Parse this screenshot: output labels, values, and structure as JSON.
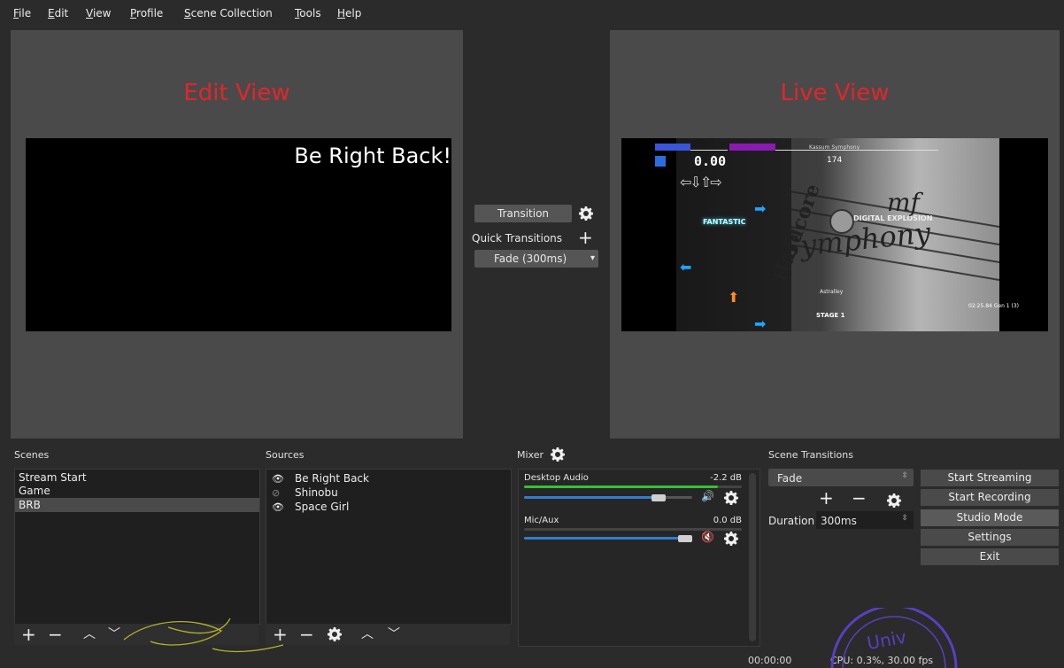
{
  "menu": {
    "items": [
      {
        "label": "File",
        "mnemonic": "F",
        "rest": "ile"
      },
      {
        "label": "Edit",
        "mnemonic": "E",
        "rest": "dit"
      },
      {
        "label": "View",
        "mnemonic": "V",
        "rest": "iew"
      },
      {
        "label": "Profile",
        "mnemonic": "P",
        "rest": "rofile"
      },
      {
        "label": "Scene Collection",
        "mnemonic": "S",
        "rest": "cene Collection"
      },
      {
        "label": "Tools",
        "mnemonic": "T",
        "rest": "ools"
      },
      {
        "label": "Help",
        "mnemonic": "H",
        "rest": "elp"
      }
    ]
  },
  "edit_view": {
    "label": "Edit View",
    "overlay_text": "Be Right Back!"
  },
  "live_view": {
    "label": "Live View",
    "game": {
      "score": "0.00",
      "song_title": "Kassum Symphony",
      "combo": "174",
      "judgement": "FANTASTIC",
      "logo_text": "DIGITAL EXPLOSION",
      "song_logo": "Symphony",
      "artist": "Hardcore",
      "stage": "STAGE 1",
      "timer": "02:25.84 Gen 1 (3)",
      "artist_small": "Astralley",
      "mark": "mf"
    }
  },
  "transition": {
    "button_label": "Transition",
    "quick_transitions_label": "Quick Transitions",
    "fade_select": "Fade (300ms)"
  },
  "scenes": {
    "title": "Scenes",
    "items": [
      {
        "label": "Stream Start",
        "selected": false
      },
      {
        "label": "Game",
        "selected": false
      },
      {
        "label": "BRB",
        "selected": true
      }
    ]
  },
  "sources": {
    "title": "Sources",
    "items": [
      {
        "label": "Be Right Back",
        "visible": true
      },
      {
        "label": "Shinobu",
        "visible": false
      },
      {
        "label": "Space Girl",
        "visible": true
      }
    ]
  },
  "mixer": {
    "title": "Mixer",
    "channels": [
      {
        "name": "Desktop Audio",
        "db": "-2.2 dB",
        "volume": 0.84,
        "level": 0.89,
        "muted": false
      },
      {
        "name": "Mic/Aux",
        "db": "0.0 dB",
        "volume": 1.0,
        "level": 0.0,
        "muted": true
      }
    ]
  },
  "scene_transitions": {
    "title": "Scene Transitions",
    "selected": "Fade",
    "duration_label": "Duration",
    "duration_value": "300ms"
  },
  "controls": {
    "start_streaming": "Start Streaming",
    "start_recording": "Start Recording",
    "studio_mode": "Studio Mode",
    "settings": "Settings",
    "exit": "Exit"
  },
  "status": {
    "time": "00:00:00",
    "cpu": "CPU: 0.3%, 30.00 fps"
  },
  "colors": {
    "accent_red": "#e2252b",
    "slider_blue": "#2f7fd0",
    "meter_green": "#35c135",
    "mute_red": "#e03a3a"
  }
}
